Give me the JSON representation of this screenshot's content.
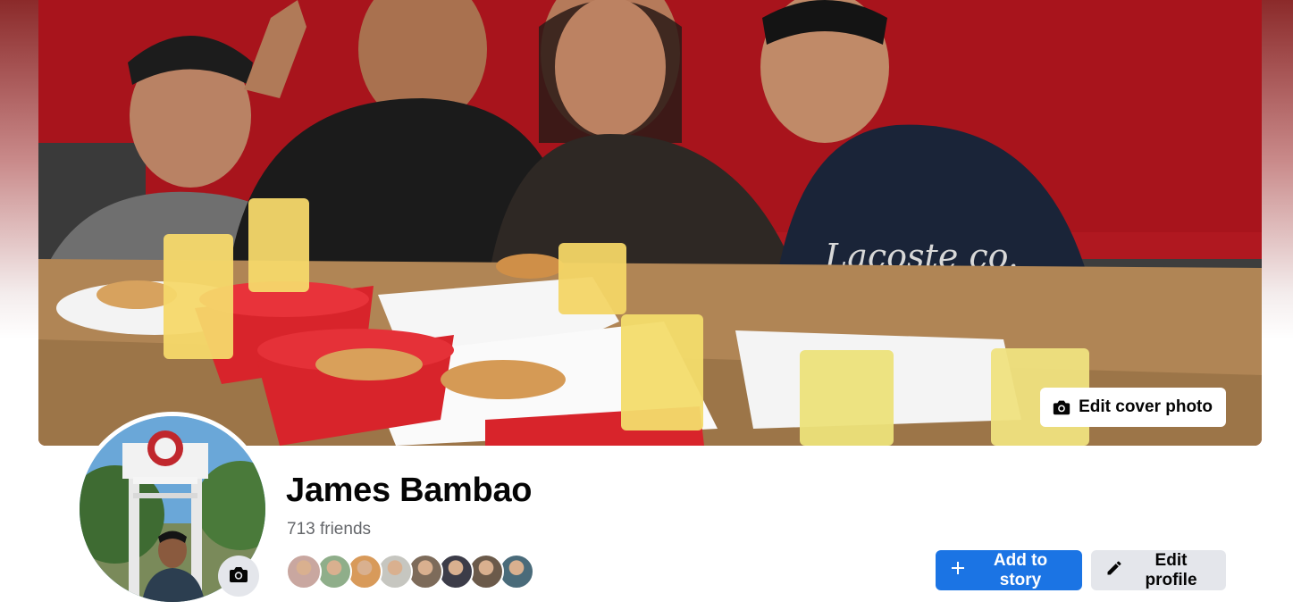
{
  "profile": {
    "name": "James Bambao",
    "friends_count_label": "713 friends"
  },
  "cover": {
    "edit_label": "Edit cover photo"
  },
  "actions": {
    "add_story_label": "Add to story",
    "edit_profile_label": "Edit profile"
  },
  "icons": {
    "cover_camera": "camera-icon",
    "avatar_camera": "camera-icon",
    "add": "plus-icon",
    "edit": "pencil-icon"
  },
  "friend_avatar_colors": [
    "#c9a7a0",
    "#8fae8a",
    "#d89a5a",
    "#c6c6c0",
    "#7d6b5a",
    "#3c3c48",
    "#6b5a4a",
    "#4a6b7a"
  ],
  "colors": {
    "primary": "#1b74e4",
    "secondary_button": "#e4e6eb",
    "text_primary": "#050505",
    "text_secondary": "#65676b"
  }
}
